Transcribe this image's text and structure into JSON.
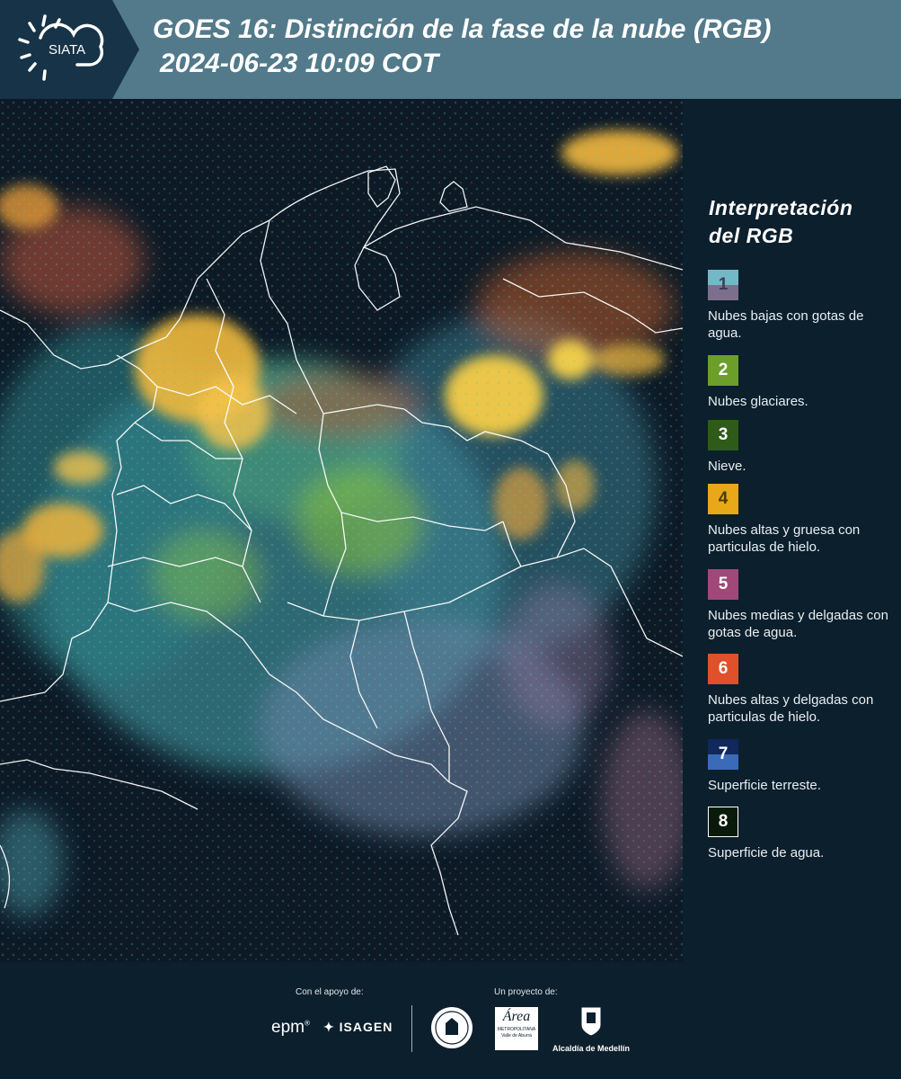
{
  "header": {
    "logo_text": "SIATA",
    "title_line1": "GOES 16: Distinción de la fase de la nube (RGB)",
    "title_line2": "2024-06-23 10:09 COT"
  },
  "legend": {
    "title_line1": "Interpretación",
    "title_line2": "del RGB",
    "items": [
      {
        "num": "1",
        "label": "Nubes bajas con gotas de agua.",
        "color_top": "#74b8c8",
        "color_bottom": "#7c6f8d",
        "num_color": "#3a3f55"
      },
      {
        "num": "2",
        "label": "Nubes glaciares.",
        "color": "#6c9e2a",
        "num_color": "#ffffff"
      },
      {
        "num": "3",
        "label": "Nieve.",
        "color": "#2e5a1a",
        "num_color": "#ffffff"
      },
      {
        "num": "4",
        "label": "Nubes altas y gruesa con particulas de hielo.",
        "color": "#e8a818",
        "num_color": "#4a3a10"
      },
      {
        "num": "5",
        "label": "Nubes medias y delgadas con gotas de agua.",
        "color": "#a04878",
        "num_color": "#ffffff"
      },
      {
        "num": "6",
        "label": "Nubes altas y delgadas con particulas de hielo.",
        "color": "#e0502a",
        "num_color": "#ffffff"
      },
      {
        "num": "7",
        "label": "Superficie terreste.",
        "color_top": "#10285c",
        "color_bottom": "#3a6ab8",
        "num_color": "#ffffff"
      },
      {
        "num": "8",
        "label": "Superficie de agua.",
        "color": "#0a1a0a",
        "border": "#ffffff",
        "num_color": "#ffffff"
      }
    ]
  },
  "footer": {
    "support_label": "Con el apoyo de:",
    "project_label": "Un proyecto de:",
    "logo_epm": "epm",
    "logo_isagen": "ISAGEN",
    "logo_area_name": "Área",
    "logo_area_sub1": "METROPOLITANA",
    "logo_area_sub2": "Valle de Aburrá",
    "logo_alcaldia": "Alcaldía de Medellín"
  }
}
